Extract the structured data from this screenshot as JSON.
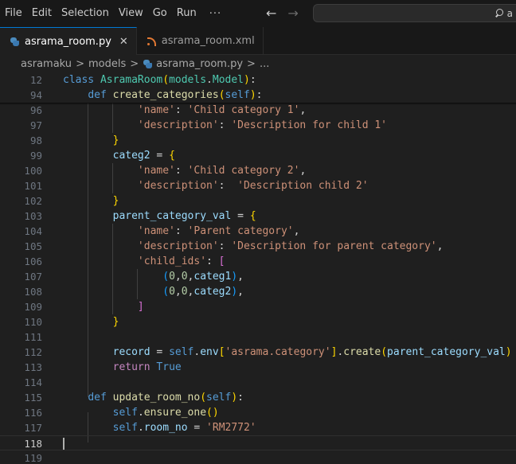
{
  "menu": {
    "items": [
      "File",
      "Edit",
      "Selection",
      "View",
      "Go",
      "Run"
    ],
    "more": "···"
  },
  "search": {
    "text": "a"
  },
  "tabs": [
    {
      "label": "asrama_room.py",
      "active": true,
      "icon": "python-file-icon",
      "close": "✕"
    },
    {
      "label": "asrama_room.xml",
      "active": false,
      "icon": "rss-file-icon"
    }
  ],
  "breadcrumb": {
    "items": [
      "asramaku",
      "models",
      "asrama_room.py",
      "..."
    ],
    "separator": ">"
  },
  "colors": {
    "background": "#1f1f1f",
    "accent": "#0078d4",
    "keyword": "#569cd6",
    "string": "#ce9178",
    "function": "#dcdcaa",
    "class": "#4ec9b0"
  },
  "editor": {
    "current_line": "118",
    "lines": [
      {
        "n": "12",
        "sticky": true,
        "tokens": [
          [
            "kw",
            "class "
          ],
          [
            "cls",
            "AsramaRoom"
          ],
          [
            "b1",
            "("
          ],
          [
            "cls",
            "models"
          ],
          [
            "op",
            "."
          ],
          [
            "cls",
            "Model"
          ],
          [
            "b1",
            ")"
          ],
          [
            "op",
            ":"
          ]
        ]
      },
      {
        "n": "94",
        "sticky": true,
        "tokens": [
          [
            "op",
            "    "
          ],
          [
            "kw",
            "def "
          ],
          [
            "fn",
            "create_categories"
          ],
          [
            "b1",
            "("
          ],
          [
            "self",
            "self"
          ],
          [
            "b1",
            ")"
          ],
          [
            "op",
            ":"
          ]
        ]
      },
      {
        "n": "96",
        "tokens": [
          [
            "op",
            "            "
          ],
          [
            "str",
            "'name'"
          ],
          [
            "op",
            ": "
          ],
          [
            "str",
            "'Child category 1'"
          ],
          [
            "op",
            ","
          ]
        ]
      },
      {
        "n": "97",
        "tokens": [
          [
            "op",
            "            "
          ],
          [
            "str",
            "'description'"
          ],
          [
            "op",
            ": "
          ],
          [
            "str",
            "'Description for child 1'"
          ]
        ]
      },
      {
        "n": "98",
        "tokens": [
          [
            "op",
            "        "
          ],
          [
            "b1",
            "}"
          ]
        ]
      },
      {
        "n": "99",
        "tokens": [
          [
            "op",
            "        "
          ],
          [
            "var",
            "categ2"
          ],
          [
            "op",
            " = "
          ],
          [
            "b1",
            "{"
          ]
        ]
      },
      {
        "n": "100",
        "tokens": [
          [
            "op",
            "            "
          ],
          [
            "str",
            "'name'"
          ],
          [
            "op",
            ": "
          ],
          [
            "str",
            "'Child category 2'"
          ],
          [
            "op",
            ","
          ]
        ]
      },
      {
        "n": "101",
        "tokens": [
          [
            "op",
            "            "
          ],
          [
            "str",
            "'description'"
          ],
          [
            "op",
            ":  "
          ],
          [
            "str",
            "'Description child 2'"
          ]
        ]
      },
      {
        "n": "102",
        "tokens": [
          [
            "op",
            "        "
          ],
          [
            "b1",
            "}"
          ]
        ]
      },
      {
        "n": "103",
        "tokens": [
          [
            "op",
            "        "
          ],
          [
            "var",
            "parent_category_val"
          ],
          [
            "op",
            " = "
          ],
          [
            "b1",
            "{"
          ]
        ]
      },
      {
        "n": "104",
        "tokens": [
          [
            "op",
            "            "
          ],
          [
            "str",
            "'name'"
          ],
          [
            "op",
            ": "
          ],
          [
            "str",
            "'Parent category'"
          ],
          [
            "op",
            ","
          ]
        ]
      },
      {
        "n": "105",
        "tokens": [
          [
            "op",
            "            "
          ],
          [
            "str",
            "'description'"
          ],
          [
            "op",
            ": "
          ],
          [
            "str",
            "'Description for parent category'"
          ],
          [
            "op",
            ","
          ]
        ]
      },
      {
        "n": "106",
        "tokens": [
          [
            "op",
            "            "
          ],
          [
            "str",
            "'child_ids'"
          ],
          [
            "op",
            ": "
          ],
          [
            "b2",
            "["
          ]
        ]
      },
      {
        "n": "107",
        "tokens": [
          [
            "op",
            "                "
          ],
          [
            "b3",
            "("
          ],
          [
            "num",
            "0"
          ],
          [
            "op",
            ","
          ],
          [
            "num",
            "0"
          ],
          [
            "op",
            ","
          ],
          [
            "var",
            "categ1"
          ],
          [
            "b3",
            ")"
          ],
          [
            "op",
            ","
          ]
        ]
      },
      {
        "n": "108",
        "tokens": [
          [
            "op",
            "                "
          ],
          [
            "b3",
            "("
          ],
          [
            "num",
            "0"
          ],
          [
            "op",
            ","
          ],
          [
            "num",
            "0"
          ],
          [
            "op",
            ","
          ],
          [
            "var",
            "categ2"
          ],
          [
            "b3",
            ")"
          ],
          [
            "op",
            ","
          ]
        ]
      },
      {
        "n": "109",
        "tokens": [
          [
            "op",
            "            "
          ],
          [
            "b2",
            "]"
          ]
        ]
      },
      {
        "n": "110",
        "tokens": [
          [
            "op",
            "        "
          ],
          [
            "b1",
            "}"
          ]
        ]
      },
      {
        "n": "111",
        "tokens": []
      },
      {
        "n": "112",
        "tokens": [
          [
            "op",
            "        "
          ],
          [
            "var",
            "record"
          ],
          [
            "op",
            " = "
          ],
          [
            "self",
            "self"
          ],
          [
            "op",
            "."
          ],
          [
            "var",
            "env"
          ],
          [
            "b1",
            "["
          ],
          [
            "str",
            "'asrama.category'"
          ],
          [
            "b1",
            "]"
          ],
          [
            "op",
            "."
          ],
          [
            "fn",
            "create"
          ],
          [
            "b1",
            "("
          ],
          [
            "var",
            "parent_category_val"
          ],
          [
            "b1",
            ")"
          ]
        ]
      },
      {
        "n": "113",
        "tokens": [
          [
            "op",
            "        "
          ],
          [
            "ctl",
            "return "
          ],
          [
            "kw",
            "True"
          ]
        ]
      },
      {
        "n": "114",
        "tokens": []
      },
      {
        "n": "115",
        "tokens": [
          [
            "op",
            "    "
          ],
          [
            "kw",
            "def "
          ],
          [
            "fn",
            "update_room_no"
          ],
          [
            "b1",
            "("
          ],
          [
            "self",
            "self"
          ],
          [
            "b1",
            ")"
          ],
          [
            "op",
            ":"
          ]
        ]
      },
      {
        "n": "116",
        "tokens": [
          [
            "op",
            "        "
          ],
          [
            "self",
            "self"
          ],
          [
            "op",
            "."
          ],
          [
            "fn",
            "ensure_one"
          ],
          [
            "b1",
            "()"
          ]
        ]
      },
      {
        "n": "117",
        "tokens": [
          [
            "op",
            "        "
          ],
          [
            "self",
            "self"
          ],
          [
            "op",
            "."
          ],
          [
            "var",
            "room_no"
          ],
          [
            "op",
            " = "
          ],
          [
            "str",
            "'RM2772'"
          ]
        ]
      },
      {
        "n": "118",
        "current": true,
        "tokens": []
      },
      {
        "n": "119",
        "tokens": []
      }
    ]
  }
}
